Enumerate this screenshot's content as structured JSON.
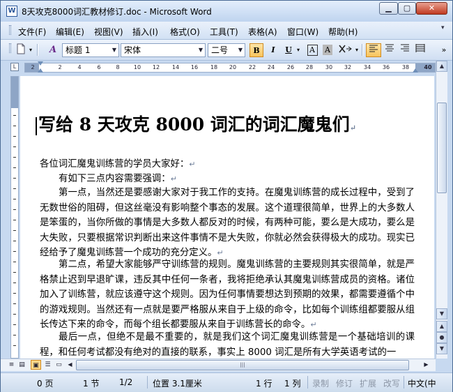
{
  "window": {
    "title": "8天攻克8000词汇教材修订.doc - Microsoft Word",
    "minimize_glyph": "▁",
    "maximize_glyph": "▢",
    "close_glyph": "✕",
    "app_icon_letter": "W"
  },
  "menu": {
    "items": [
      "文件(F)",
      "编辑(E)",
      "视图(V)",
      "插入(I)",
      "格式(O)",
      "工具(T)",
      "表格(A)",
      "窗口(W)",
      "帮助(H)"
    ],
    "overflow_glyph": "▾"
  },
  "toolbar": {
    "style_icon_text": "A",
    "style_value": "标题 1",
    "font_value": "宋体",
    "size_value": "二号",
    "bold_label": "B",
    "italic_label": "I",
    "underline_label": "U",
    "char_border_label": "A",
    "char_shading_label": "A",
    "overflow_glyph": "»"
  },
  "ruler": {
    "ticks": [
      "2",
      "2",
      "4",
      "6",
      "8",
      "10",
      "12",
      "14",
      "16",
      "18",
      "20",
      "22",
      "24",
      "26",
      "28",
      "30",
      "32",
      "34",
      "36",
      "38",
      "40"
    ],
    "tab_stop_glyph": "L"
  },
  "document": {
    "title": "写给 8 天攻克 8000 词汇的词汇魔鬼们",
    "paragraph_mark": "↵",
    "paragraphs": [
      "各位词汇魔鬼训练营的学员大家好：",
      "有如下三点内容需要强调：",
      "第一点，当然还是要感谢大家对于我工作的支持。在魔鬼训练营的成长过程中，受到了无数世俗的阻碍，但这丝毫没有影响整个事态的发展。这个道理很简单，世界上的大多数人是笨蛋的，当你所做的事情是大多数人都反对的时候，有两种可能，要么是大成功，要么是大失败，只要根据常识判断出来这件事情不是大失败，你就必然会获得极大的成功。现实已经给予了魔鬼训练营一个成功的充分定义。",
      "第二点，希望大家能够严守训练营的规则。魔鬼训练营的主要规则其实很简单，就是严格禁止迟到早退旷课，违反其中任何一条者，我将拒绝承认其魔鬼训练营成员的资格。诸位加入了训练营，就应该遵守这个规则。因为任何事情要想达到预期的效果，都需要遵循个中的游戏规则。当然还有一点就是要严格服从来自于上级的命令，比如每个训练组都要服从组长传达下来的命令，而每个组长都要服从来自于训练营长的命令。",
      "最后一点，但绝不是最不重要的，就是我们这个词汇魔鬼训练营是一个基础培训的课程，和任何考试都没有绝对的直接的联系，事实上 8000 词汇是所有大学英语考试的一"
    ]
  },
  "scrollbar": {
    "up_glyph": "▲",
    "down_glyph": "▼",
    "prev_page_glyph": "▲",
    "select_browse_glyph": "●",
    "next_page_glyph": "▼",
    "left_glyph": "◀",
    "right_glyph": "▶",
    "thumb_grip": "|||"
  },
  "view_buttons": [
    "≡",
    "▤",
    "▣",
    "☰",
    "▭"
  ],
  "status": {
    "page": "0 页",
    "section": "1 节",
    "page_of": "1/2",
    "position": "位置 3.1厘米",
    "line": "1 行",
    "column": "1 列",
    "rec": "录制",
    "trk": "修订",
    "ext": "扩展",
    "ovr": "改写",
    "language": "中文(中"
  }
}
